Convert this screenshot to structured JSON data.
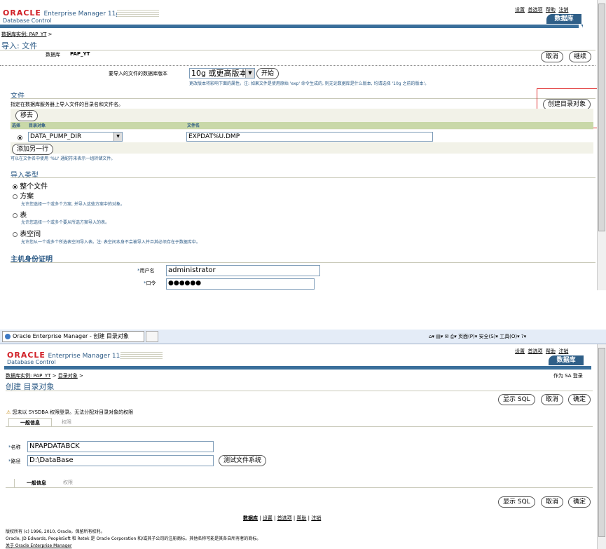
{
  "top": {
    "logo_oracle": "ORACLE",
    "logo_em": "Enterprise Manager 11",
    "logo_g": "g",
    "logo_db_control": "Database Control",
    "global_links": [
      "设置",
      "首选项",
      "帮助",
      "注销"
    ],
    "db_tab": "数据库",
    "breadcrumb_link": "数据库实例: PAP_YT",
    "breadcrumb_sep": ">",
    "page_title": "导入: 文件",
    "db_label": "数据库",
    "db_value": "PAP_YT",
    "cancel_btn": "取消",
    "continue_btn": "继续",
    "version_label": "要导入的文件的数据库版本",
    "version_value": "10g 或更高版本",
    "go_btn": "开始",
    "version_hint": "更改版本将影响下面的属性。注: 如果文件是使用原始 'exp' 命令生成的, 则无论数据库是什么版本, 均请选择 '10g 之前的版本'。",
    "files_title": "文件",
    "files_desc": "指定在数据库服务器上导入文件的目录名和文件名。",
    "create_dir_btn": "创建目录对象",
    "remove_btn": "移去",
    "col_select": "选择",
    "col_dir": "目录对象",
    "col_filename": "文件名",
    "dir_value": "DATA_PUMP_DIR",
    "filename_value": "EXPDAT%U.DMP",
    "add_row_btn": "添加另一行",
    "wildcard_hint": "可以在文件名中使用 '%U' 通配符来表示一组转储文件。",
    "import_type_title": "导入类型",
    "import_types": [
      {
        "label": "整个文件",
        "desc": ""
      },
      {
        "label": "方案",
        "desc": "允许您选择一个或多个方案, 并导入这些方案中的对象。"
      },
      {
        "label": "表",
        "desc": "允许您选择一个或多个要从所选方案导入的表。"
      },
      {
        "label": "表空间",
        "desc": "允许您从一个或多个所选表空间导入表。注: 表空间本身不会被导入并且其必须存在于数据库中。"
      }
    ],
    "host_cred_title": "主机身份证明",
    "username_label": "用户名",
    "username_value": "administrator",
    "password_label": "口令",
    "password_value": "●●●●●●"
  },
  "bottom": {
    "ie_tab_title": "Oracle Enterprise Manager - 创建 目录对象",
    "ie_toolbar": [
      "页面(P)",
      "安全(S)",
      "工具(O)"
    ],
    "logo_oracle": "ORACLE",
    "logo_em": "Enterprise Manager 11",
    "logo_g": "g",
    "logo_db_control": "Database Control",
    "global_links": [
      "设置",
      "首选项",
      "帮助",
      "注销"
    ],
    "db_tab": "数据库",
    "breadcrumb_link1": "数据库实例: PAP_YT",
    "breadcrumb_link2": "目录对象",
    "breadcrumb_sep": ">",
    "page_title": "创建 目录对象",
    "logged_as": "作为 SA 登录",
    "show_sql_btn": "显示 SQL",
    "cancel_btn": "取消",
    "ok_btn": "确定",
    "warning": "您未以 SYSDBA 权限登录。无法分配对目录对象的权限",
    "tab_general": "一般信息",
    "tab_privs": "权限",
    "name_label": "名称",
    "name_value": "NPAPDATABCK",
    "path_label": "路径",
    "path_value": "D:\\DataBase",
    "test_fs_btn": "测试文件系统",
    "footer_links": [
      "数据库",
      "设置",
      "首选项",
      "帮助",
      "注销"
    ],
    "copyright": "版权所有 (c) 1996, 2010, Oracle。保留所有权利。",
    "trademark": "Oracle, JD Edwards, PeopleSoft 和 Retek 是 Oracle Corporation 和/或其子公司的注册商标。其他名称可能是其各自所有者的商标。",
    "about_link": "关于 Oracle Enterprise Manager"
  },
  "colors": {
    "accent": "#2d5b86",
    "oracle_red": "#d12027",
    "highlight_box": "#e03030",
    "table_header": "#c9d8a8"
  }
}
